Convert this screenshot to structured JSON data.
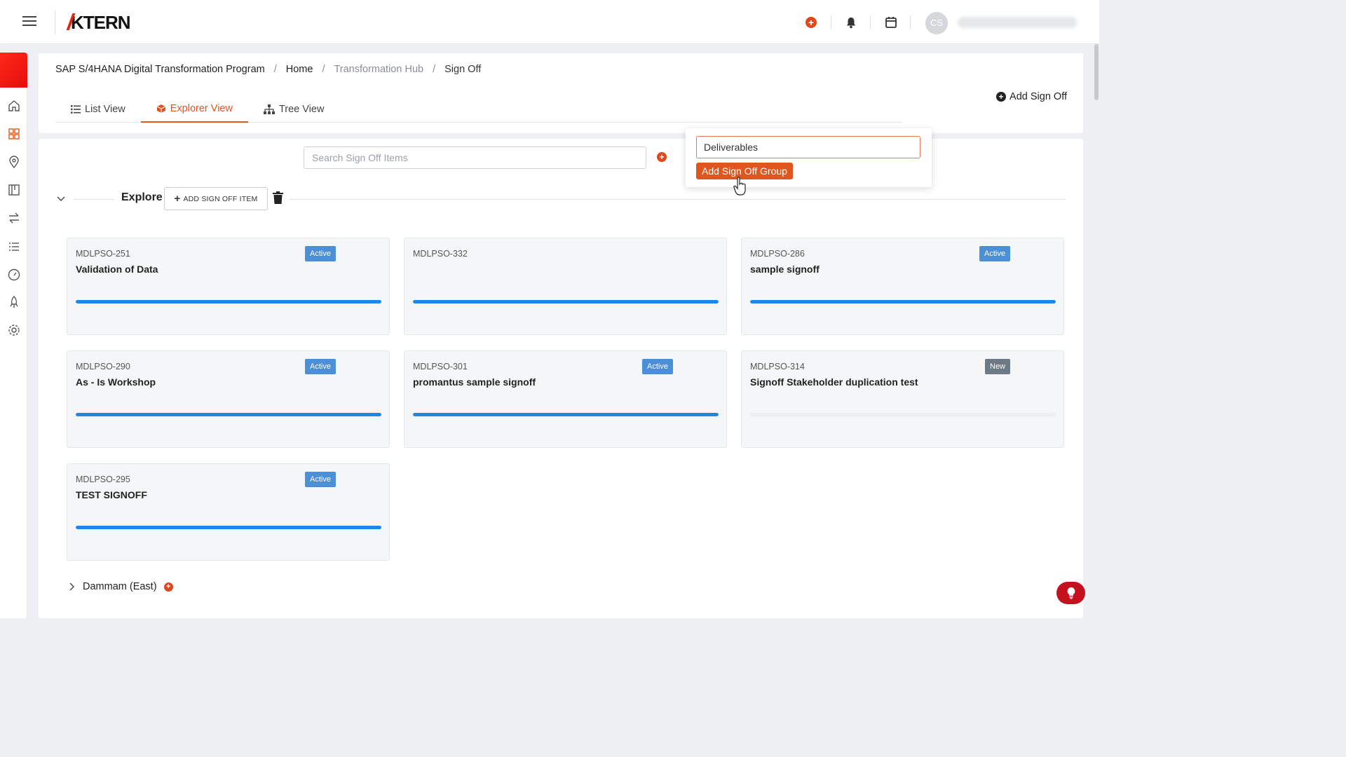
{
  "app": {
    "logo": "TERN",
    "logo_k": "K"
  },
  "topbar": {
    "avatar_initials": "CS"
  },
  "breadcrumb": [
    "SAP S/4HANA Digital Transformation Program",
    "Home",
    "Transformation Hub",
    "Sign Off"
  ],
  "tabs": [
    {
      "label": "List View",
      "icon": "list-icon"
    },
    {
      "label": "Explorer View",
      "icon": "cube-icon",
      "active": true
    },
    {
      "label": "Tree View",
      "icon": "hierarchy-icon"
    }
  ],
  "actions": {
    "add_sign_off": "Add Sign Off"
  },
  "search": {
    "placeholder": "Search Sign Off Items",
    "value": ""
  },
  "explore": {
    "title": "Explore",
    "add_item": "ADD SIGN OFF ITEM"
  },
  "cards": [
    {
      "code": "MDLPSO-251",
      "title": "Validation of Data",
      "status": "Active",
      "progress": 1.0
    },
    {
      "code": "MDLPSO-332",
      "title": "",
      "status": "",
      "progress": 1.0
    },
    {
      "code": "MDLPSO-286",
      "title": "sample signoff",
      "status": "Active",
      "progress": 1.0
    },
    {
      "code": "MDLPSO-290",
      "title": "As - Is Workshop",
      "status": "Active",
      "progress": 1.0
    },
    {
      "code": "MDLPSO-301",
      "title": "promantus sample signoff",
      "status": "Active",
      "progress": 1.0
    },
    {
      "code": "MDLPSO-314",
      "title": "Signoff Stakeholder duplication test",
      "status": "New",
      "progress": 0.0
    },
    {
      "code": "MDLPSO-295",
      "title": "TEST SIGNOFF",
      "status": "Active",
      "progress": 1.0
    }
  ],
  "groups": [
    {
      "label": "Dammam (East)"
    }
  ],
  "popup": {
    "input_value": "Deliverables",
    "button": "Add Sign Off Group"
  },
  "colors": {
    "accent": "#e0561f",
    "active_badge": "#4b8fd6",
    "new_badge": "#6c7a86",
    "progress": "#1f86e8",
    "brand_red": "#e42313"
  }
}
